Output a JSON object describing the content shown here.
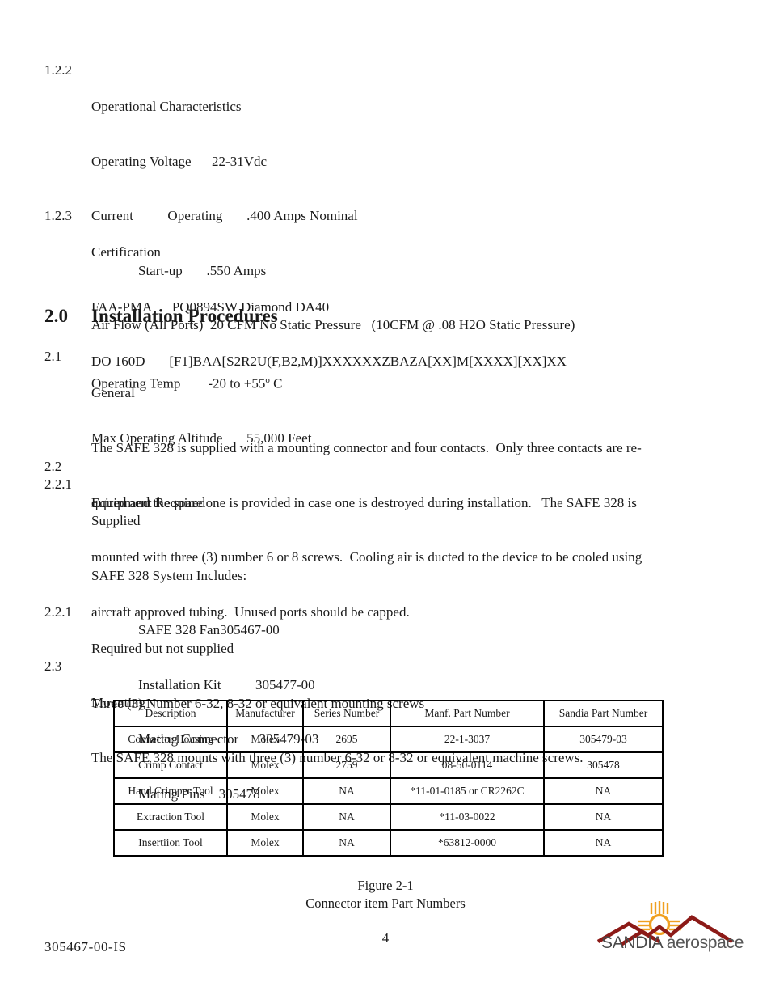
{
  "document": {
    "doc_number": "305467-00-IS",
    "page_number": "4"
  },
  "sections": {
    "s122": {
      "number": "1.2.2",
      "title": "Operational Characteristics",
      "lines": [
        "Operating Voltage      22-31Vdc",
        "Current          Operating       .400 Amps Nominal",
        "Air Flow (All Ports)  20 CFM No Static Pressure   (10CFM @ .08 H2O Static Pressure)",
        "Operating Temp        -20 to +55",
        "Max Operating Altitude       55,000 Feet"
      ],
      "startup_line": "Start-up       .550 Amps",
      "temp_degree": "o",
      "temp_unit": " C"
    },
    "s123": {
      "number": "1.2.3",
      "title": "Certification",
      "lines": [
        "FAA-PMA      PQ0894SW Diamond DA40",
        "DO 160D       [F1]BAA[S2R2U(F,B2,M)]XXXXXXZBAZA[XX]M[XXXX][XX]XX"
      ]
    },
    "heading20": {
      "number": "2.0",
      "title": "Installation Procedures"
    },
    "s21": {
      "number": "2.1",
      "title": "General",
      "paragraph_lines": [
        "The SAFE 328 is supplied with a mounting connector and four contacts.  Only three contacts are re-",
        "quired and the spare one is provided in case one is destroyed during installation.   The SAFE 328 is",
        "mounted with three (3) number 6 or 8 screws.  Cooling air is ducted to the device to be cooled using",
        "aircraft approved tubing.  Unused ports should be capped."
      ]
    },
    "s22": {
      "number": "2.2",
      "title": "Equipment Required"
    },
    "s221a": {
      "number": "2.2.1",
      "title": "Supplied",
      "includes_label": "SAFE 328 System Includes:",
      "items": [
        "SAFE 328 Fan305467-00",
        "Installation Kit          305477-00",
        "Mating Connector      305479-03",
        "Mating Pins    305478"
      ]
    },
    "s221b": {
      "number": "2.2.1",
      "title": "Required but not supplied",
      "lines": [
        "Three (3) Number 6-32, 8-32 or equivalent mounting screws"
      ]
    },
    "s23": {
      "number": "2.3",
      "title": "Mounting",
      "lines": [
        "The SAFE 328 mounts with three (3) number 6-32 or 8-32 or equivalent machine screws."
      ]
    }
  },
  "parts_table": {
    "headers": [
      "Description",
      "Manufacturer",
      "Series Number",
      "Manf. Part Number",
      "Sandia Part Number"
    ],
    "rows": [
      [
        "Connector Housing",
        "Molex",
        "2695",
        "22-1-3037",
        "305479-03"
      ],
      [
        "Crimp Contact",
        "Molex",
        "2759",
        "08-50-0114",
        "305478"
      ],
      [
        "Hand Crimper Tool",
        "Molex",
        "NA",
        "*11-01-0185 or CR2262C",
        "NA"
      ],
      [
        "Extraction Tool",
        "Molex",
        "NA",
        "*11-03-0022",
        "NA"
      ],
      [
        "Insertiion Tool",
        "Molex",
        "NA",
        "*63812-0000",
        "NA"
      ]
    ]
  },
  "figure": {
    "number": "Figure 2-1",
    "caption": "Connector item Part Numbers"
  },
  "logo": {
    "name_primary": "SANDIA",
    "name_secondary": " aerospace",
    "mountain_color": "#8c1a17",
    "sun_color": "#f0a020"
  }
}
